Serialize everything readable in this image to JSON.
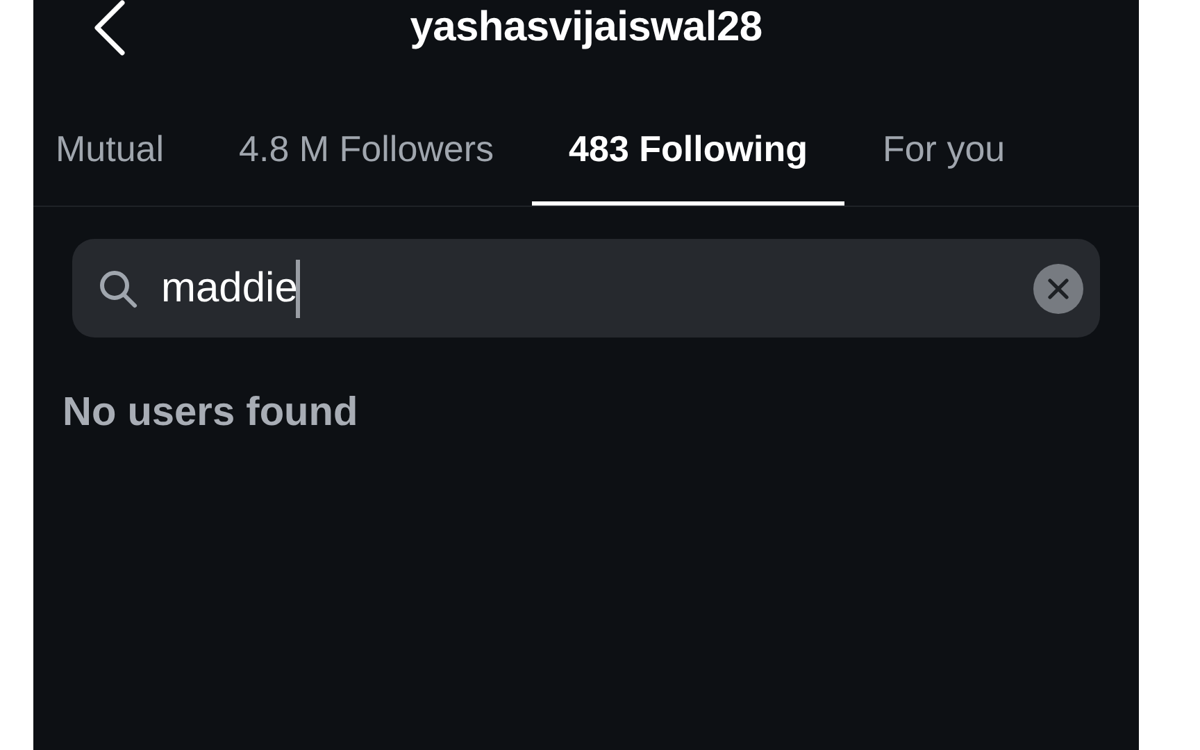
{
  "header": {
    "title": "yashasvijaiswal28"
  },
  "tabs": [
    {
      "label": "Mutual",
      "selected": false
    },
    {
      "label": "4.8 M Followers",
      "selected": false
    },
    {
      "label": "483 Following",
      "selected": true
    },
    {
      "label": "For you",
      "selected": false
    }
  ],
  "search": {
    "value": "maddie"
  },
  "message": "No users found"
}
